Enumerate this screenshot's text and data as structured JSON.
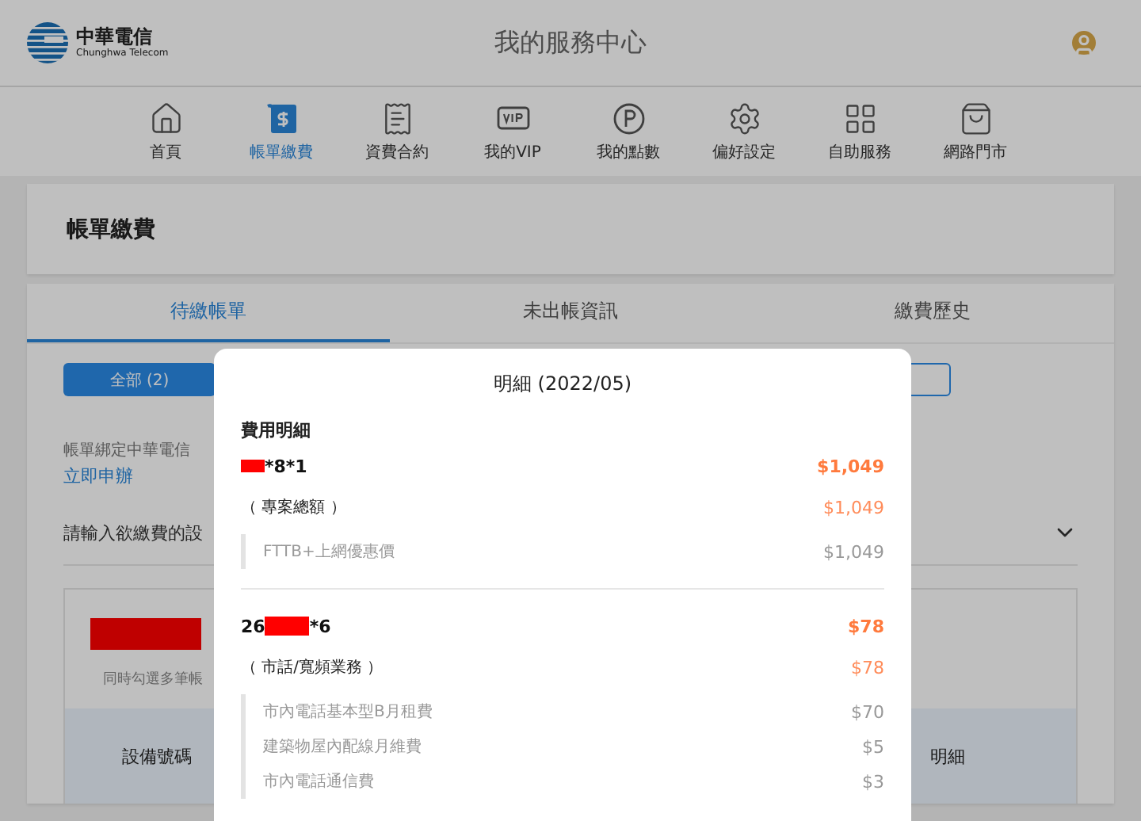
{
  "header": {
    "brand_name": "中華電信",
    "brand_subtitle": "Chunghwa Telecom",
    "title": "我的服務中心"
  },
  "nav": [
    {
      "label": "首頁",
      "selected": false
    },
    {
      "label": "帳單繳費",
      "selected": true
    },
    {
      "label": "資費合約",
      "selected": false
    },
    {
      "label": "我的VIP",
      "selected": false
    },
    {
      "label": "我的點數",
      "selected": false
    },
    {
      "label": "偏好設定",
      "selected": false
    },
    {
      "label": "自助服務",
      "selected": false
    },
    {
      "label": "網路門市",
      "selected": false
    }
  ],
  "page_title": "帳單繳費",
  "tabs": [
    {
      "label": "待繳帳單",
      "selected": true
    },
    {
      "label": "未出帳資訊",
      "selected": false
    },
    {
      "label": "繳費歷史",
      "selected": false
    }
  ],
  "filter_button": "全部 (2)",
  "notice": "帳單綁定中華電信",
  "notice_link": "立即申辦",
  "device_prompt": "請輸入欲繳費的設",
  "bill_box": {
    "hint": "同時勾選多筆帳",
    "columns": [
      "設備號碼",
      "明細"
    ]
  },
  "modal": {
    "title": "明細 (2022/05)",
    "section_title": "費用明細",
    "accounts": [
      {
        "number_suffix": "*8*1",
        "total": "$1,049",
        "group": "（ 專案總額 ）",
        "group_total": "$1,049",
        "items": [
          {
            "name": "FTTB+上網優惠價",
            "amount": "$1,049"
          }
        ]
      },
      {
        "number_prefix": "26",
        "number_suffix": "*6",
        "total": "$78",
        "group": "（ 市話/寬頻業務 ）",
        "group_total": "$78",
        "items": [
          {
            "name": "市內電話基本型B月租費",
            "amount": "$70"
          },
          {
            "name": "建築物屋內配線月維費",
            "amount": "$5"
          },
          {
            "name": "市內電話通信費",
            "amount": "$3"
          }
        ]
      }
    ]
  }
}
